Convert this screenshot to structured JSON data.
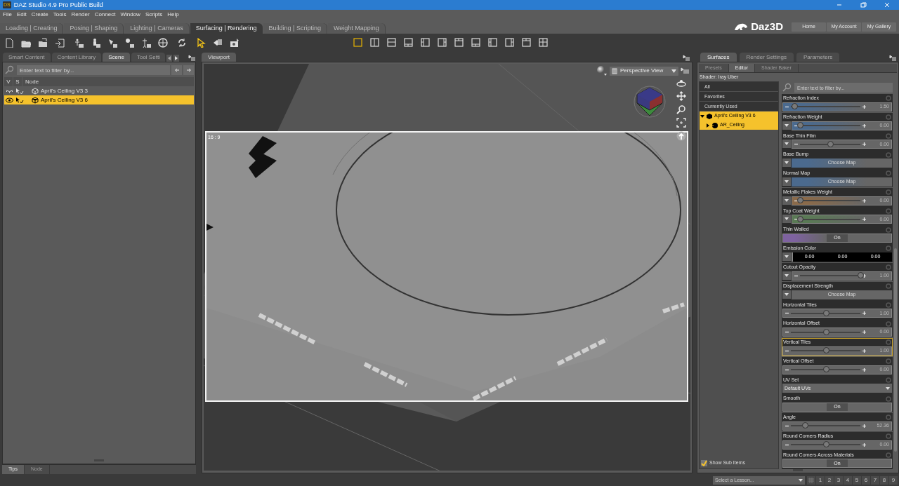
{
  "window": {
    "badge": "DS",
    "title": "DAZ Studio 4.9 Pro Public Build"
  },
  "menu": [
    "File",
    "Edit",
    "Create",
    "Tools",
    "Render",
    "Connect",
    "Window",
    "Scripts",
    "Help"
  ],
  "rooms": [
    {
      "label": "Loading | Creating",
      "selected": false
    },
    {
      "label": "Posing | Shaping",
      "selected": false
    },
    {
      "label": "Lighting | Cameras",
      "selected": false
    },
    {
      "label": "Surfacing | Rendering",
      "selected": true
    },
    {
      "label": "Building | Scripting",
      "selected": false
    },
    {
      "label": "Weight Mapping",
      "selected": false
    }
  ],
  "brand": "Daz3D",
  "nav_buttons": [
    "Home",
    "My Account",
    "My Gallery"
  ],
  "viewport_layouts": [
    {
      "kind": "single",
      "selected": true
    },
    {
      "kind": "split-v",
      "selected": false
    },
    {
      "kind": "split-h",
      "selected": false
    },
    {
      "kind": "bottom",
      "selected": false
    },
    {
      "kind": "left",
      "selected": false
    },
    {
      "kind": "right",
      "selected": false
    },
    {
      "kind": "top",
      "selected": false
    },
    {
      "kind": "bottom",
      "selected": false
    },
    {
      "kind": "left",
      "selected": false
    },
    {
      "kind": "right",
      "selected": false
    },
    {
      "kind": "top",
      "selected": false
    },
    {
      "kind": "quad",
      "selected": false
    }
  ],
  "left_panel": {
    "tabs": [
      {
        "label": "Smart Content",
        "selected": false
      },
      {
        "label": "Content Library",
        "selected": false
      },
      {
        "label": "Scene",
        "selected": true
      },
      {
        "label": "Tool Setti",
        "selected": false
      }
    ],
    "filter_placeholder": "Enter text to filter by...",
    "columns": [
      "V",
      "S",
      "Node"
    ],
    "nodes": [
      {
        "label": "April's Ceiling V3 3",
        "visible": false,
        "selected": false
      },
      {
        "label": "April's Ceiling V3 6",
        "visible": true,
        "selected": true
      }
    ],
    "bottom_tabs": [
      {
        "label": "Tips",
        "selected": true
      },
      {
        "label": "Node",
        "selected": false
      }
    ]
  },
  "viewport": {
    "tab": "Viewport",
    "view": "Perspective View",
    "aspect": "16 : 9"
  },
  "right_panel": {
    "tabs": [
      {
        "label": "Surfaces",
        "selected": true
      },
      {
        "label": "Render Settings",
        "selected": false
      },
      {
        "label": "Parameters",
        "selected": false
      }
    ],
    "subtabs": [
      {
        "label": "Presets",
        "selected": false
      },
      {
        "label": "Editor",
        "selected": true
      },
      {
        "label": "Shader Baker",
        "selected": false
      }
    ],
    "shader": "Shader: Iray Uber",
    "groups": [
      {
        "label": "All",
        "selected": false
      },
      {
        "label": "Favorites",
        "selected": false
      },
      {
        "label": "Currently Used",
        "selected": false
      }
    ],
    "tree": [
      {
        "label": "April's Ceiling V3 6",
        "selected": true,
        "expanded": true,
        "children": [
          {
            "label": "AR_Ceiling",
            "selected": true,
            "expanded": false
          }
        ]
      }
    ],
    "filter_placeholder": "Enter text to filter by...",
    "properties": [
      {
        "kind": "slider",
        "label": "Refraction Index",
        "menu": false,
        "color": "#4b6a8e",
        "level": 0.05,
        "value": "1.50",
        "selected": false
      },
      {
        "kind": "slider",
        "label": "Refraction Weight",
        "menu": true,
        "color": "#4b6a8e",
        "level": 0,
        "value": "0.00",
        "selected": false
      },
      {
        "kind": "slider",
        "label": "Base Thin Film",
        "menu": true,
        "level": 0.5,
        "value": "0.00",
        "selected": false
      },
      {
        "kind": "map",
        "label": "Base Bump",
        "button": "Choose Map",
        "color": "#4b6a8e"
      },
      {
        "kind": "map",
        "label": "Normal Map",
        "button": "Choose Map",
        "color": "#4b6a8e"
      },
      {
        "kind": "slider",
        "label": "Metallic Flakes Weight",
        "menu": true,
        "color": "#8a6a4a",
        "level": 0,
        "value": "0.00",
        "selected": false
      },
      {
        "kind": "slider",
        "label": "Top Coat Weight",
        "menu": true,
        "color": "#5a7a55",
        "level": 0,
        "value": "0.00",
        "selected": false
      },
      {
        "kind": "toggle",
        "label": "Thin Walled",
        "state": "On",
        "on": true,
        "color": "#7e62a0"
      },
      {
        "kind": "color",
        "label": "Emission Color",
        "values": [
          "0.00",
          "0.00",
          "0.00"
        ]
      },
      {
        "kind": "slider",
        "label": "Cutout Opacity",
        "menu": true,
        "level": 1,
        "value": "1.00",
        "selected": false
      },
      {
        "kind": "map",
        "label": "Displacement Strength",
        "button": "Choose Map"
      },
      {
        "kind": "slider",
        "label": "Horizontal Tiles",
        "menu": false,
        "level": 0.5,
        "value": "1.00",
        "selected": false
      },
      {
        "kind": "slider",
        "label": "Horizontal Offset",
        "menu": false,
        "level": 0.5,
        "value": "0.00",
        "selected": false
      },
      {
        "kind": "slider",
        "label": "Vertical Tiles",
        "menu": false,
        "level": 0.5,
        "value": "1.00",
        "selected": true
      },
      {
        "kind": "slider",
        "label": "Vertical Offset",
        "menu": false,
        "level": 0.5,
        "value": "0.00",
        "selected": false
      },
      {
        "kind": "dropdown",
        "label": "UV Set",
        "value": "Default UVs"
      },
      {
        "kind": "toggle",
        "label": "Smooth",
        "state": "On",
        "on": true
      },
      {
        "kind": "slider",
        "label": "Angle",
        "menu": false,
        "level": 0.2,
        "value": "52.36",
        "selected": false
      },
      {
        "kind": "slider",
        "label": "Round Corners Radius",
        "menu": false,
        "level": 0.5,
        "value": "0.00",
        "selected": false
      },
      {
        "kind": "toggle",
        "label": "Round Corners Across Materials",
        "state": "On",
        "on": true
      }
    ],
    "show_sub_items": {
      "label": "Show Sub Items",
      "checked": true
    }
  },
  "lesson": {
    "placeholder": "Select a Lesson...",
    "steps": [
      "1",
      "2",
      "3",
      "4",
      "5",
      "6",
      "7",
      "8",
      "9"
    ]
  }
}
